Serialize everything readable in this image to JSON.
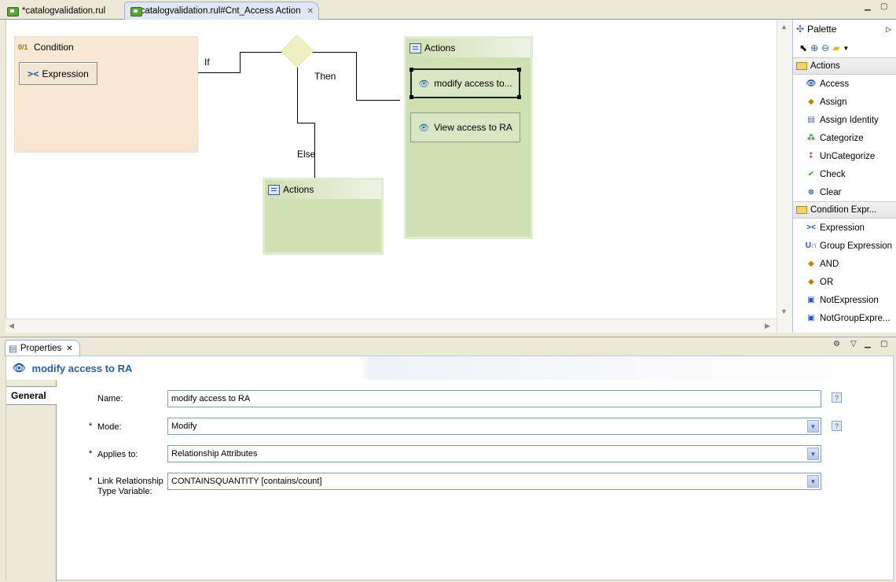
{
  "editor": {
    "tabs": [
      {
        "label": "*catalogvalidation.rul"
      },
      {
        "label": "*catalogvalidation.rul#Cnt_Access Action"
      }
    ]
  },
  "diagram": {
    "condition_title": "Condition",
    "expression_label": "Expression",
    "if_label": "If",
    "then_label": "Then",
    "else_label": "Else",
    "then_actions_title": "Actions",
    "else_actions_title": "Actions",
    "then_actions": [
      {
        "label": "modify access  to..."
      },
      {
        "label": "View access to RA"
      }
    ]
  },
  "palette": {
    "title": "Palette",
    "actions_drawer": "Actions",
    "actions": [
      "Access",
      "Assign",
      "Assign Identity",
      "Categorize",
      "UnCategorize",
      "Check",
      "Clear"
    ],
    "cond_drawer": "Condition Expr...",
    "conditions": [
      "Expression",
      "Group Expression",
      "AND",
      "OR",
      "NotExpression",
      "NotGroupExpre..."
    ]
  },
  "properties": {
    "tab_label": "Properties",
    "header": "modify access  to RA",
    "general_tab": "General",
    "name_label": "Name:",
    "name_value": "modify access  to RA",
    "mode_label": "Mode:",
    "mode_value": "Modify",
    "applies_label": "Applies to:",
    "applies_value": "Relationship Attributes",
    "link_label_1": "Link Relationship",
    "link_label_2": "Type Variable:",
    "link_value": "CONTAINSQUANTITY   [contains/count]",
    "required_mark": "*",
    "help_mark": "?"
  }
}
